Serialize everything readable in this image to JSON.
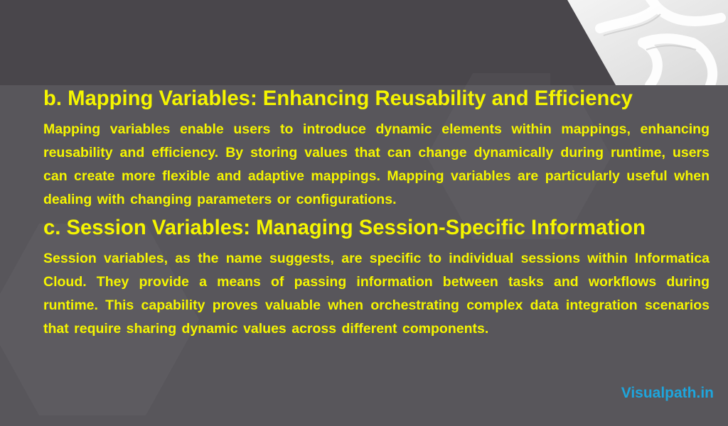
{
  "slide": {
    "sections": [
      {
        "heading": "b. Mapping Variables: Enhancing Reusability and Efficiency",
        "body": "Mapping variables enable users to introduce dynamic elements within mappings, enhancing reusability and efficiency. By storing values that can change dynamically during runtime, users can create more flexible and adaptive mappings. Mapping variables are particularly useful when dealing with changing parameters or configurations."
      },
      {
        "heading": "c. Session Variables: Managing Session-Specific Information",
        "body": "Session variables, as the name suggests, are specific to individual sessions within Informatica Cloud. They provide a means of passing information between tasks and workflows during runtime. This capability proves valuable when orchestrating complex data integration scenarios that require sharing dynamic values across different components."
      }
    ],
    "brand": "Visualpath.in",
    "colors": {
      "text": "#f5f500",
      "brand": "#1ea5dc",
      "background": "#58565b",
      "top_band": "#49464b"
    }
  }
}
